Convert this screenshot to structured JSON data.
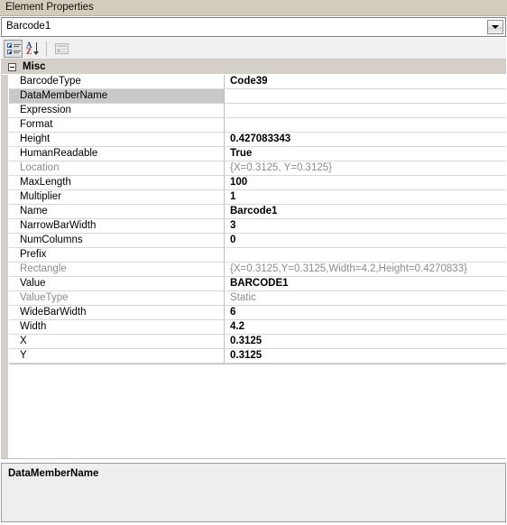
{
  "window": {
    "title": "Element Properties"
  },
  "object_selector": {
    "value": "Barcode1",
    "dropdown_icon": "chevron-down-icon"
  },
  "toolbar": {
    "buttons": [
      {
        "name": "categorized-view-button",
        "icon": "categorized-list-icon",
        "tooltip": "Categorized",
        "pressed": true,
        "enabled": true
      },
      {
        "name": "alphabetical-view-button",
        "icon": "sort-alphabetical-icon",
        "tooltip": "Alphabetical",
        "pressed": false,
        "enabled": true
      },
      {
        "name": "property-pages-button",
        "icon": "property-pages-icon",
        "tooltip": "Property Pages",
        "pressed": false,
        "enabled": false
      }
    ]
  },
  "grid": {
    "category": "Misc",
    "category_expanded": true,
    "rows": [
      {
        "name": "BarcodeType",
        "value": "Code39",
        "readonly": false,
        "selected": false
      },
      {
        "name": "DataMemberName",
        "value": "",
        "readonly": false,
        "selected": true
      },
      {
        "name": "Expression",
        "value": "",
        "readonly": false,
        "selected": false
      },
      {
        "name": "Format",
        "value": "",
        "readonly": false,
        "selected": false
      },
      {
        "name": "Height",
        "value": "0.427083343",
        "readonly": false,
        "selected": false
      },
      {
        "name": "HumanReadable",
        "value": "True",
        "readonly": false,
        "selected": false
      },
      {
        "name": "Location",
        "value": "{X=0.3125, Y=0.3125}",
        "readonly": true,
        "selected": false
      },
      {
        "name": "MaxLength",
        "value": "100",
        "readonly": false,
        "selected": false
      },
      {
        "name": "Multiplier",
        "value": "1",
        "readonly": false,
        "selected": false
      },
      {
        "name": "Name",
        "value": "Barcode1",
        "readonly": false,
        "selected": false
      },
      {
        "name": "NarrowBarWidth",
        "value": "3",
        "readonly": false,
        "selected": false
      },
      {
        "name": "NumColumns",
        "value": "0",
        "readonly": false,
        "selected": false
      },
      {
        "name": "Prefix",
        "value": "",
        "readonly": false,
        "selected": false
      },
      {
        "name": "Rectangle",
        "value": "{X=0.3125,Y=0.3125,Width=4.2,Height=0.4270833}",
        "readonly": true,
        "selected": false
      },
      {
        "name": "Value",
        "value": "BARCODE1",
        "readonly": false,
        "selected": false
      },
      {
        "name": "ValueType",
        "value": "Static",
        "readonly": true,
        "selected": false
      },
      {
        "name": "WideBarWidth",
        "value": "6",
        "readonly": false,
        "selected": false
      },
      {
        "name": "Width",
        "value": "4.2",
        "readonly": false,
        "selected": false
      },
      {
        "name": "X",
        "value": "0.3125",
        "readonly": false,
        "selected": false
      },
      {
        "name": "Y",
        "value": "0.3125",
        "readonly": false,
        "selected": false
      }
    ]
  },
  "description": {
    "title": "DataMemberName",
    "text": ""
  },
  "colors": {
    "titlebar": "#d4ccbb",
    "gutter": "#d4d0c8",
    "selection": "#c8c8c8",
    "readonly_text": "#8b8b8b",
    "description_bg": "#eeeeee"
  }
}
